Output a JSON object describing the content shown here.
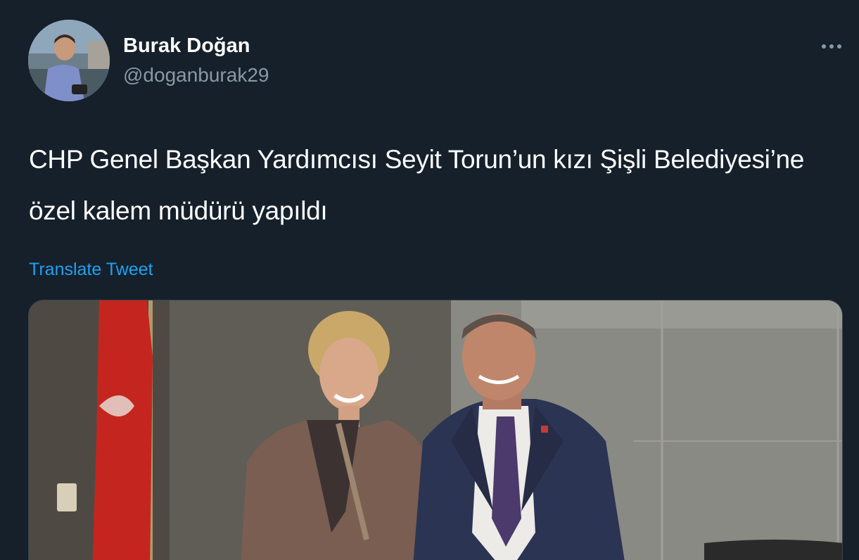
{
  "author": {
    "name": "Burak Doğan",
    "handle": "@doganburak29",
    "avatar_icon": "profile-photo"
  },
  "tweet": {
    "text": "CHP Genel Başkan Yardımcısı Seyit Torun’un kızı Şişli Belediyesi’ne özel kalem müdürü yapıldı",
    "translate_label": "Translate Tweet"
  },
  "media": {
    "type": "photo",
    "icon": "photo-of-two-people-beside-flag"
  },
  "colors": {
    "background": "#15202b",
    "text_primary": "#ffffff",
    "text_secondary": "#8899a6",
    "link": "#1da1f2"
  },
  "menu": {
    "more_icon": "more-horizontal-icon"
  }
}
